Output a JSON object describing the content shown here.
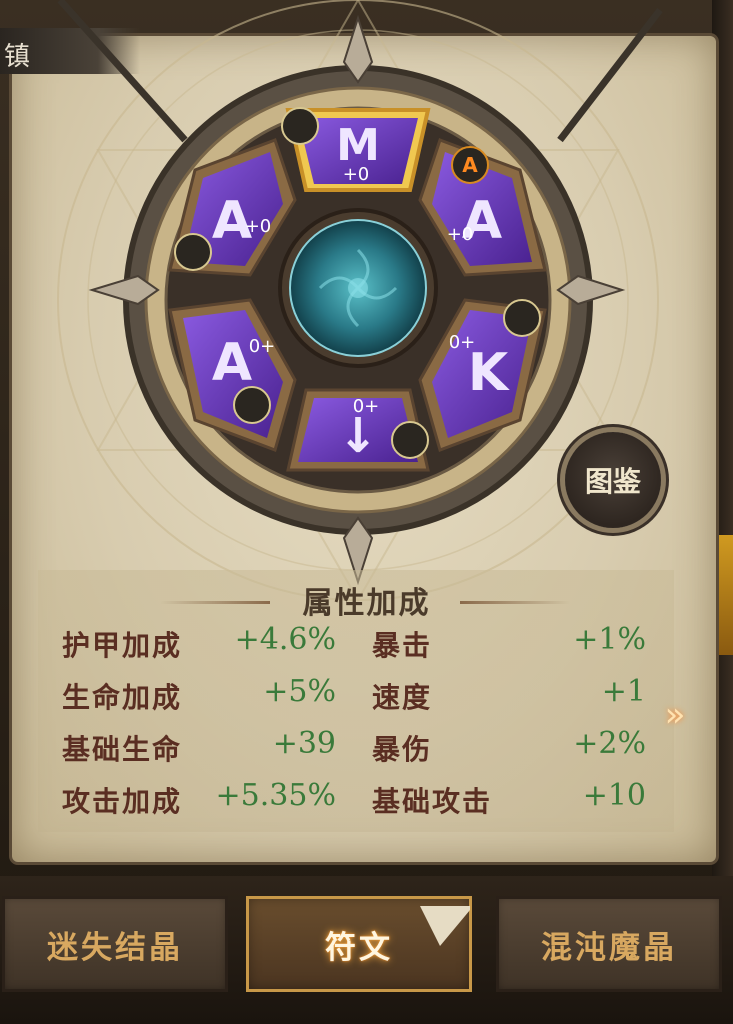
{
  "header": {
    "title": "镇"
  },
  "wheel": {
    "runes": [
      {
        "name": "rune-slot-top",
        "level": "+0",
        "glyph": "M"
      },
      {
        "name": "rune-slot-upper-right",
        "level": "+0",
        "glyph": "A"
      },
      {
        "name": "rune-slot-lower-right",
        "level": "0+",
        "glyph": "K"
      },
      {
        "name": "rune-slot-bottom",
        "level": "0+",
        "glyph": "↓"
      },
      {
        "name": "rune-slot-lower-left",
        "level": "0+",
        "glyph": "A"
      },
      {
        "name": "rune-slot-upper-left",
        "level": "+0",
        "glyph": "A"
      }
    ]
  },
  "handbook_button": {
    "label": "图鉴"
  },
  "stats": {
    "title": "属性加成",
    "rows": [
      {
        "left_label": "护甲加成",
        "left_value": "+4.6%",
        "right_label": "暴击",
        "right_value": "+1%"
      },
      {
        "left_label": "生命加成",
        "left_value": "+5%",
        "right_label": "速度",
        "right_value": "+1"
      },
      {
        "left_label": "基础生命",
        "left_value": "+39",
        "right_label": "暴伤",
        "right_value": "+2%"
      },
      {
        "left_label": "攻击加成",
        "left_value": "+5.35%",
        "right_label": "基础攻击",
        "right_value": "+10"
      }
    ]
  },
  "tabs": {
    "lost_crystal": "迷失结晶",
    "rune": "符文",
    "chaos_crystal": "混沌魔晶"
  },
  "colors": {
    "parchment": "#dccfb2",
    "rune_purple": "#6a3ab8",
    "value_green": "#3a7a3a",
    "label_brown": "#5a2e22",
    "gold_highlight": "#e8b040"
  }
}
